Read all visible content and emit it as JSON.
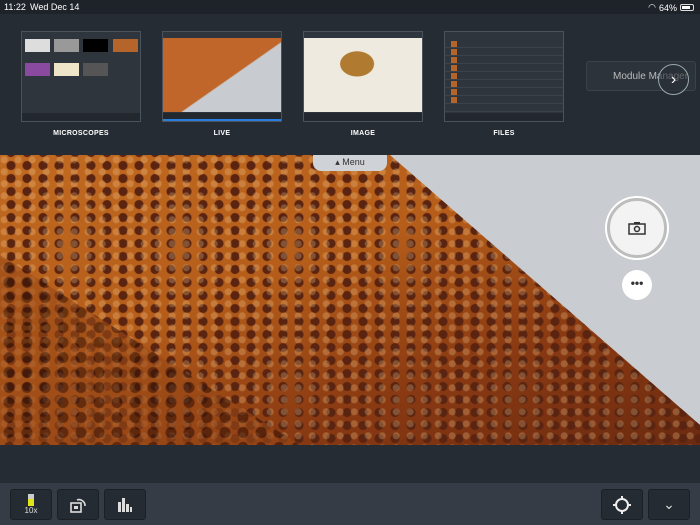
{
  "status": {
    "time": "11:22",
    "date": "Wed Dec 14",
    "battery": "64%",
    "battery_level": 0.64,
    "icons": [
      "wifi-icon",
      "battery-icon"
    ]
  },
  "modules": [
    {
      "label": "MICROSCOPES",
      "active": false
    },
    {
      "label": "LIVE",
      "active": true
    },
    {
      "label": "IMAGE",
      "active": false
    },
    {
      "label": "FILES",
      "active": false
    }
  ],
  "module_manager": {
    "label": "Module Manager",
    "next_icon": "chevron-right-icon"
  },
  "menu_tab": {
    "label": "Menu",
    "icon": "triangle-up-icon"
  },
  "viewer": {
    "capture_icon": "camera-icon",
    "more_label": "•••"
  },
  "toolbar": {
    "objective_label": "10x",
    "objective_color": "#e4e41a",
    "accent": "#2a7de1"
  }
}
